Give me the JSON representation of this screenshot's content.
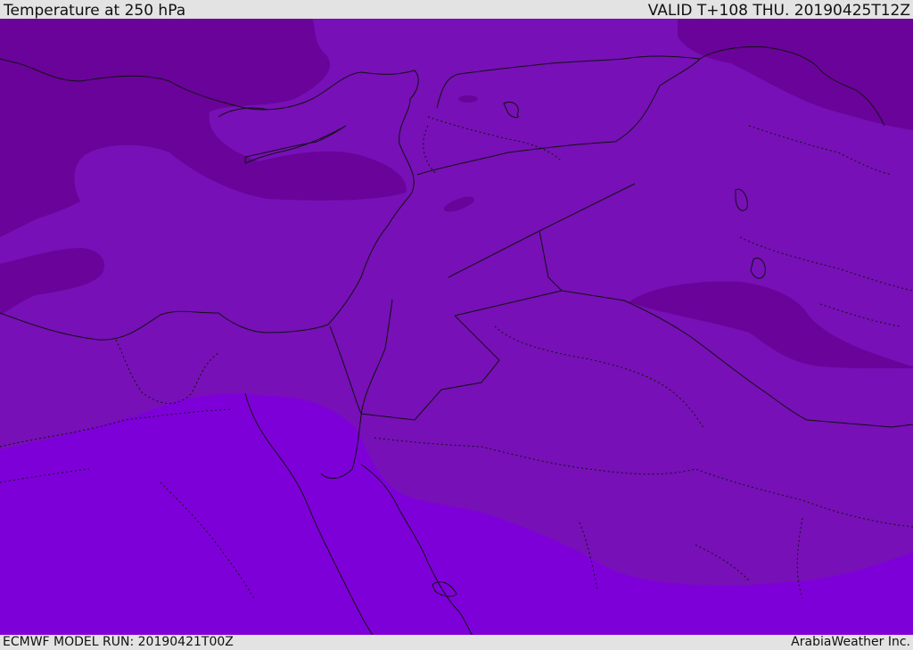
{
  "header": {
    "title": "Temperature at 250 hPa",
    "valid": "VALID T+108 THU. 20190425T12Z"
  },
  "footer": {
    "model_run": "ECMWF MODEL RUN: 20190421T00Z",
    "brand": "ArabiaWeather Inc."
  },
  "map": {
    "region": "Eastern Mediterranean and Middle East",
    "field": "temperature",
    "level": "250 hPa",
    "colors": {
      "coldest_band": "#6a0399",
      "mid_band": "#7710b6",
      "warm_band": "#7e00d9",
      "border_line": "#111111"
    }
  }
}
